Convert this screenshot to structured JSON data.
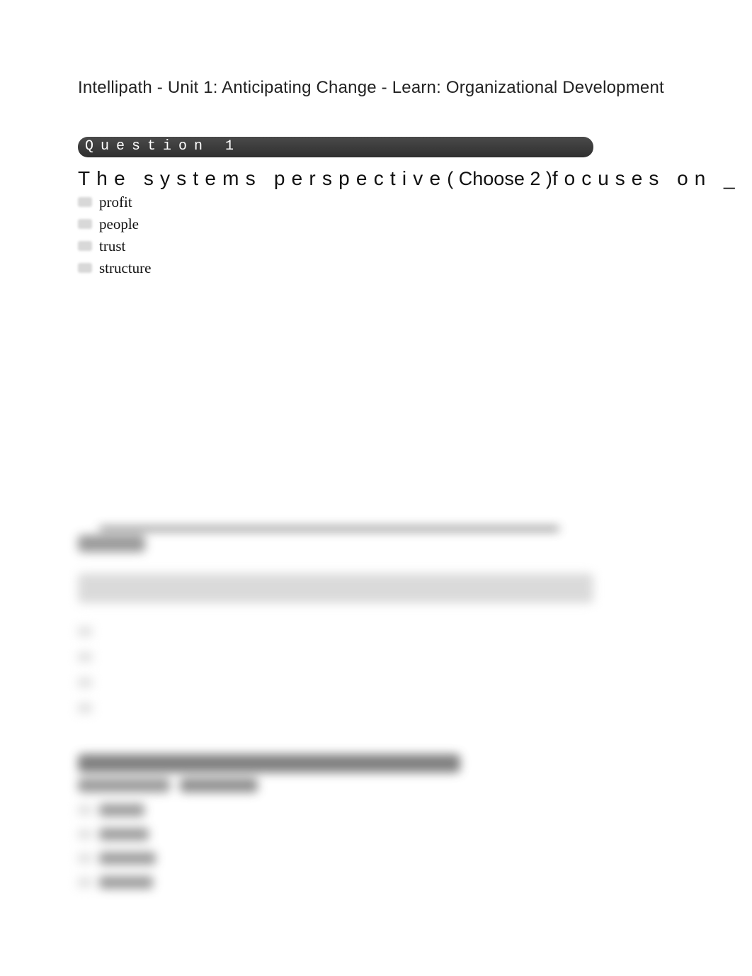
{
  "breadcrumb": "Intellipath - Unit 1: Anticipating Change - Learn: Organizational Development",
  "question1": {
    "header": "Question 1",
    "text_prefix": "The systems perspective",
    "choose_hint": "( Choose 2 )",
    "text_suffix": "focuses on _",
    "options": [
      {
        "label": "profit"
      },
      {
        "label": "people"
      },
      {
        "label": "trust"
      },
      {
        "label": "structure"
      }
    ]
  }
}
